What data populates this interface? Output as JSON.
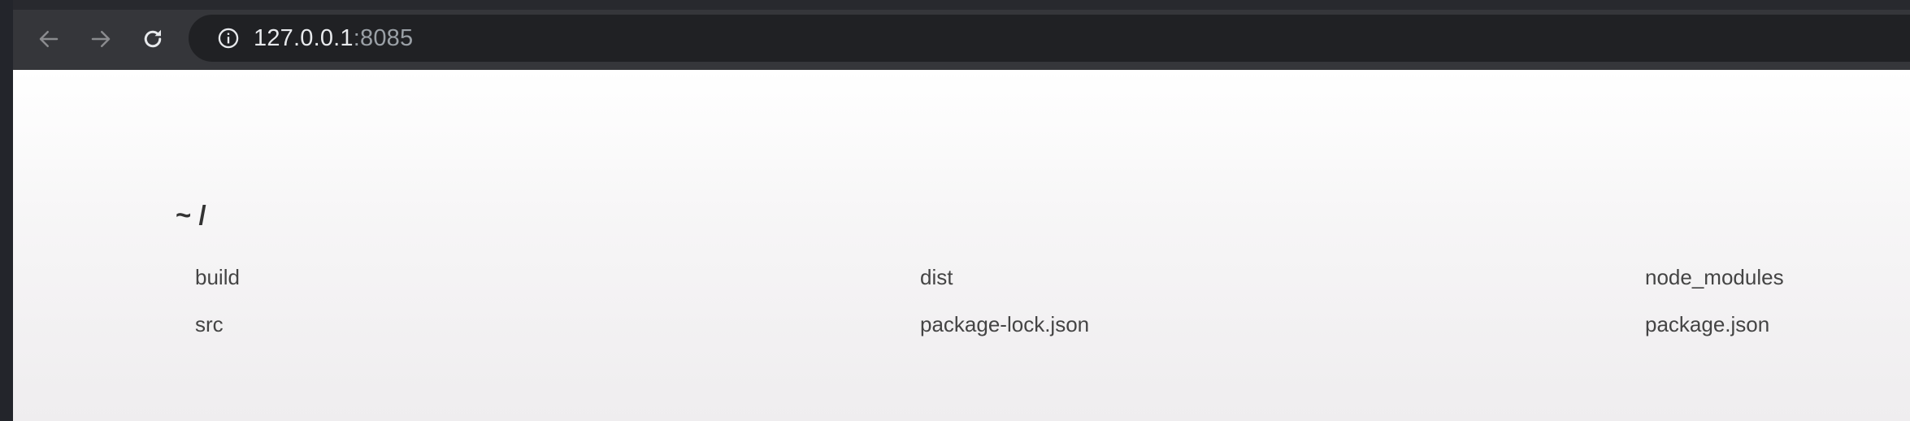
{
  "browser": {
    "url_host": "127.0.0.1",
    "url_port": ":8085",
    "icons": {
      "back": "arrow-left-icon",
      "forward": "arrow-right-icon",
      "reload": "reload-icon",
      "site_info": "info-icon"
    }
  },
  "listing": {
    "path": "~ /",
    "files": [
      "build",
      "dist",
      "node_modules",
      "src",
      "package-lock.json",
      "package.json"
    ]
  },
  "colors": {
    "chrome_bg": "#35363a",
    "omnibox_bg": "#202124",
    "url_text": "#e8eaed",
    "url_port_text": "#9aa0a6",
    "page_text": "#444444"
  }
}
